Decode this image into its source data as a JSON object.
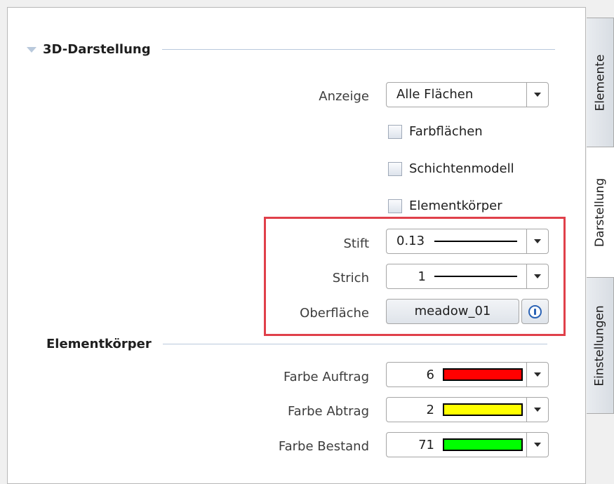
{
  "sections": {
    "darstellung_3d": {
      "title": "3D-Darstellung"
    },
    "elementkoerper": {
      "title": "Elementkörper"
    }
  },
  "fields": {
    "anzeige": {
      "label": "Anzeige",
      "value": "Alle Flächen"
    },
    "stift": {
      "label": "Stift",
      "value": "0.13"
    },
    "strich": {
      "label": "Strich",
      "value": "1"
    },
    "oberflaeche": {
      "label": "Oberfläche",
      "value": "meadow_01"
    },
    "farbe_auftrag": {
      "label": "Farbe Auftrag",
      "value": "6",
      "color": "#ff0000"
    },
    "farbe_abtrag": {
      "label": "Farbe Abtrag",
      "value": "2",
      "color": "#ffff00"
    },
    "farbe_bestand": {
      "label": "Farbe Bestand",
      "value": "71",
      "color": "#00ff00"
    }
  },
  "checkboxes": [
    {
      "label": "Farbflächen",
      "checked": false
    },
    {
      "label": "Schichtenmodell",
      "checked": false
    },
    {
      "label": "Elementkörper",
      "checked": false
    }
  ],
  "tabs": [
    {
      "label": "Elemente",
      "active": false
    },
    {
      "label": "Darstellung",
      "active": true
    },
    {
      "label": "Einstellungen",
      "active": false
    }
  ],
  "icons": {
    "section_toggle": "collapse-triangle-icon",
    "dropdown": "chevron-down-icon",
    "info": "info-icon"
  },
  "colors": {
    "highlight": "#e0404a",
    "section_rule": "#b9c9dc",
    "info_icon": "#2b63b5"
  }
}
